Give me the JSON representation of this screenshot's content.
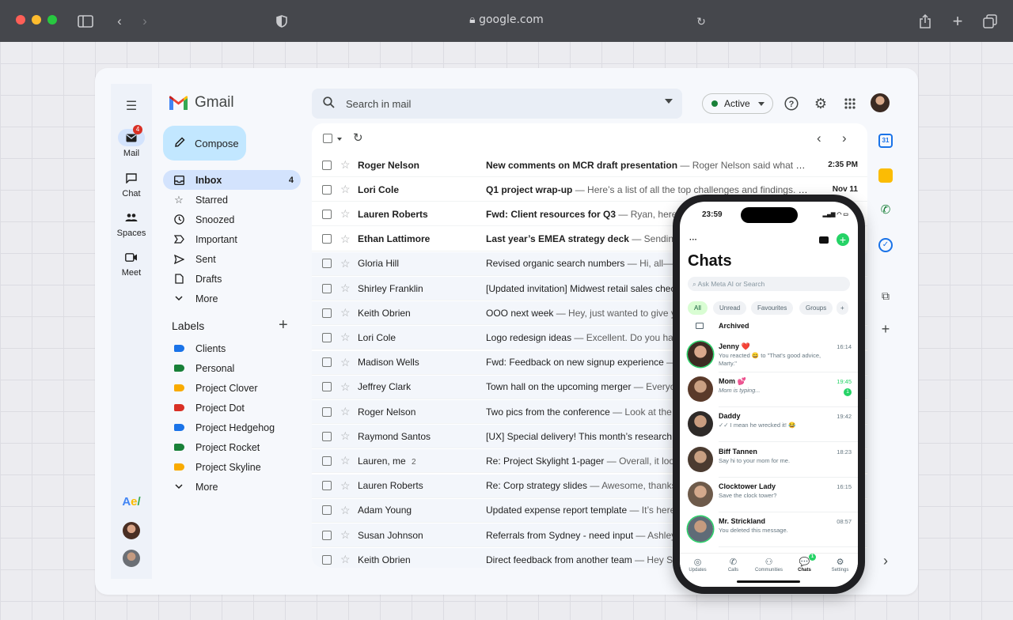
{
  "browser": {
    "url": "google.com"
  },
  "gmail": {
    "brand": "Gmail",
    "rail": [
      {
        "label": "Mail",
        "badge": "4"
      },
      {
        "label": "Chat"
      },
      {
        "label": "Spaces"
      },
      {
        "label": "Meet"
      }
    ],
    "compose_label": "Compose",
    "nav": [
      {
        "label": "Inbox",
        "count": "4",
        "icon": "inbox-icon"
      },
      {
        "label": "Starred",
        "icon": "star-icon"
      },
      {
        "label": "Snoozed",
        "icon": "clock-icon"
      },
      {
        "label": "Important",
        "icon": "important-icon"
      },
      {
        "label": "Sent",
        "icon": "send-icon"
      },
      {
        "label": "Drafts",
        "icon": "draft-icon"
      },
      {
        "label": "More",
        "icon": "chevron-down-icon"
      }
    ],
    "labels_heading": "Labels",
    "labels": [
      {
        "label": "Clients",
        "color": "#1a73e8"
      },
      {
        "label": "Personal",
        "color": "#188038"
      },
      {
        "label": "Project Clover",
        "color": "#f9ab00"
      },
      {
        "label": "Project Dot",
        "color": "#d93025"
      },
      {
        "label": "Project Hedgehog",
        "color": "#1a73e8"
      },
      {
        "label": "Project Rocket",
        "color": "#188038"
      },
      {
        "label": "Project Skyline",
        "color": "#f9ab00"
      },
      {
        "label": "More",
        "color": ""
      }
    ],
    "search_placeholder": "Search in mail",
    "status_label": "Active",
    "emails": [
      {
        "sender": "Roger Nelson",
        "subject": "New comments on MCR draft presentation",
        "snippet": " — Roger Nelson said what abou...",
        "time": "2:35 PM",
        "unread": true
      },
      {
        "sender": "Lori Cole",
        "subject": "Q1 project wrap-up",
        "snippet": " — Here’s a list of all the top challenges and findings. Sur...",
        "time": "Nov 11",
        "unread": true
      },
      {
        "sender": "Lauren Roberts",
        "subject": "Fwd: Client resources for Q3",
        "snippet": " — Ryan, here’s t",
        "time": "",
        "unread": true
      },
      {
        "sender": "Ethan Lattimore",
        "subject": "Last year’s EMEA strategy deck",
        "snippet": " — Sending",
        "time": "",
        "unread": true
      },
      {
        "sender": "Gloria Hill",
        "subject": "Revised organic search numbers",
        "snippet": " — Hi, all—the",
        "time": "",
        "unread": false
      },
      {
        "sender": "Shirley Franklin",
        "subject": "[Updated invitation] Midwest retail sales check",
        "snippet": "",
        "time": "",
        "unread": false
      },
      {
        "sender": "Keith Obrien",
        "subject": "OOO next week",
        "snippet": " — Hey, just wanted to give you",
        "time": "",
        "unread": false
      },
      {
        "sender": "Lori Cole",
        "subject": "Logo redesign ideas",
        "snippet": " — Excellent. Do you have",
        "time": "",
        "unread": false
      },
      {
        "sender": "Madison Wells",
        "subject": "Fwd: Feedback on new signup experience",
        "snippet": " — L",
        "time": "",
        "unread": false
      },
      {
        "sender": "Jeffrey Clark",
        "subject": "Town hall on the upcoming merger",
        "snippet": " — Everyone",
        "time": "",
        "unread": false
      },
      {
        "sender": "Roger Nelson",
        "subject": "Two pics from the conference",
        "snippet": " — Look at the si",
        "time": "",
        "unread": false
      },
      {
        "sender": "Raymond Santos",
        "subject": "[UX] Special delivery! This month’s research re",
        "snippet": "",
        "time": "",
        "unread": false
      },
      {
        "sender": "Lauren, me",
        "count": "2",
        "subject": "Re: Project Skylight 1-pager",
        "snippet": " — Overall, it looks",
        "time": "",
        "unread": false
      },
      {
        "sender": "Lauren Roberts",
        "subject": "Re: Corp strategy slides",
        "snippet": " — Awesome, thanks! I",
        "time": "",
        "unread": false
      },
      {
        "sender": "Adam Young",
        "subject": "Updated expense report template",
        "snippet": " — It’s here!",
        "time": "",
        "unread": false
      },
      {
        "sender": "Susan Johnson",
        "subject": "Referrals from Sydney - need input",
        "snippet": " — Ashley a",
        "time": "",
        "unread": false
      },
      {
        "sender": "Keith Obrien",
        "subject": "Direct feedback from another team",
        "snippet": " — Hey Su",
        "time": "",
        "unread": false
      }
    ]
  },
  "whatsapp": {
    "clock": "23:59",
    "title": "Chats",
    "search_placeholder": "Ask Meta AI or Search",
    "filters": [
      "All",
      "Unread",
      "Favourites",
      "Groups"
    ],
    "archived_label": "Archived",
    "chats": [
      {
        "name": "Jenny ❤️",
        "message": "You reacted 😄 to \"That's good advice, Marty.\"",
        "time": "16:14"
      },
      {
        "name": "Mom 💕",
        "message": "Mom is typing...",
        "time": "19:45",
        "unread": "1"
      },
      {
        "name": "Daddy",
        "message": "✓✓ I mean he wrecked it! 😂",
        "time": "19:42"
      },
      {
        "name": "Biff Tannen",
        "message": "Say hi to your mom for me.",
        "time": "18:23"
      },
      {
        "name": "Clocktower Lady",
        "message": "Save the clock tower?",
        "time": "16:15"
      },
      {
        "name": "Mr. Strickland",
        "message": "You deleted this message.",
        "time": "08:57"
      }
    ],
    "tabs": [
      "Updates",
      "Calls",
      "Communities",
      "Chats",
      "Settings"
    ],
    "chats_tab_badge": "1"
  }
}
